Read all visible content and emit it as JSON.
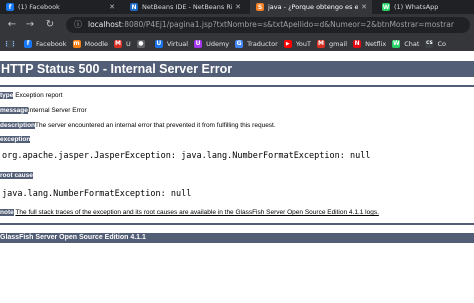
{
  "tabs": [
    {
      "label": "(1) Facebook",
      "icon": "facebook-icon",
      "color": "#1877f2",
      "glyph": "f"
    },
    {
      "label": "NetBeans IDE - NetBeans Rich",
      "icon": "netbeans-icon",
      "color": "#1b6ac6",
      "glyph": "N"
    },
    {
      "label": "java - ¿Porque obtengo es error",
      "icon": "stackoverflow-icon",
      "color": "#f48024",
      "glyph": "S"
    },
    {
      "label": "(1) WhatsApp",
      "icon": "whatsapp-icon",
      "color": "#25d366",
      "glyph": "W"
    }
  ],
  "toolbar": {
    "url_host": "localhost",
    "url_path": ":8080/P4Ej1/pagina1.jsp?txtNombre=s&txtApellido=d&Numeor=2&btnMostrar=mostrar"
  },
  "bookmarks": [
    {
      "label": "",
      "icon": "apps-grid-icon",
      "color": "#8ab4f8",
      "glyph": "⋮⋮"
    },
    {
      "label": "Facebook",
      "icon": "facebook-icon",
      "color": "#1877f2",
      "glyph": "f"
    },
    {
      "label": "Moodle",
      "icon": "moodle-icon",
      "color": "#f98012",
      "glyph": "m"
    },
    {
      "label": "U",
      "icon": "gmail-icon",
      "color": "#d93025",
      "glyph": "M"
    },
    {
      "label": "",
      "icon": "globe-icon",
      "color": "#5f6368",
      "glyph": "●"
    },
    {
      "label": "Virtual",
      "icon": "virtual-icon",
      "color": "#1a73e8",
      "glyph": "U"
    },
    {
      "label": "Udemy",
      "icon": "udemy-icon",
      "color": "#a435f0",
      "glyph": "U"
    },
    {
      "label": "Traductor",
      "icon": "translate-icon",
      "color": "#4285f4",
      "glyph": "G"
    },
    {
      "label": "YouT",
      "icon": "youtube-icon",
      "color": "#ff0000",
      "glyph": "▶"
    },
    {
      "label": "gmail",
      "icon": "gmail-icon",
      "color": "#d93025",
      "glyph": "M"
    },
    {
      "label": "Netflix",
      "icon": "netflix-icon",
      "color": "#e50914",
      "glyph": "N"
    },
    {
      "label": "Chat",
      "icon": "whatsapp-icon",
      "color": "#25d366",
      "glyph": "W"
    },
    {
      "label": "Co",
      "icon": "cs-icon",
      "color": "#3c4043",
      "glyph": "CS"
    }
  ],
  "page": {
    "title": "HTTP Status 500 - Internal Server Error",
    "type_label": "type",
    "type_value": "Exception report",
    "message_label": "message",
    "message_value": "Internal Server Error",
    "description_label": "description",
    "description_value": "The server encountered an internal error that prevented it from fulfilling this request.",
    "exception_label": "exception",
    "exception_value": "org.apache.jasper.JasperException: java.lang.NumberFormatException: null",
    "root_cause_label": "root cause",
    "root_cause_value": "java.lang.NumberFormatException: null",
    "note_label": "note",
    "note_value": "The full stack traces of the exception and its root causes are available in the GlassFish Server Open Source Edition 4.1.1 logs.",
    "footer": "GlassFish Server Open Source Edition 4.1.1"
  },
  "colors": {
    "tomcat_header": "#525d76",
    "browser_dark": "#35363a",
    "tabstrip": "#202124"
  }
}
